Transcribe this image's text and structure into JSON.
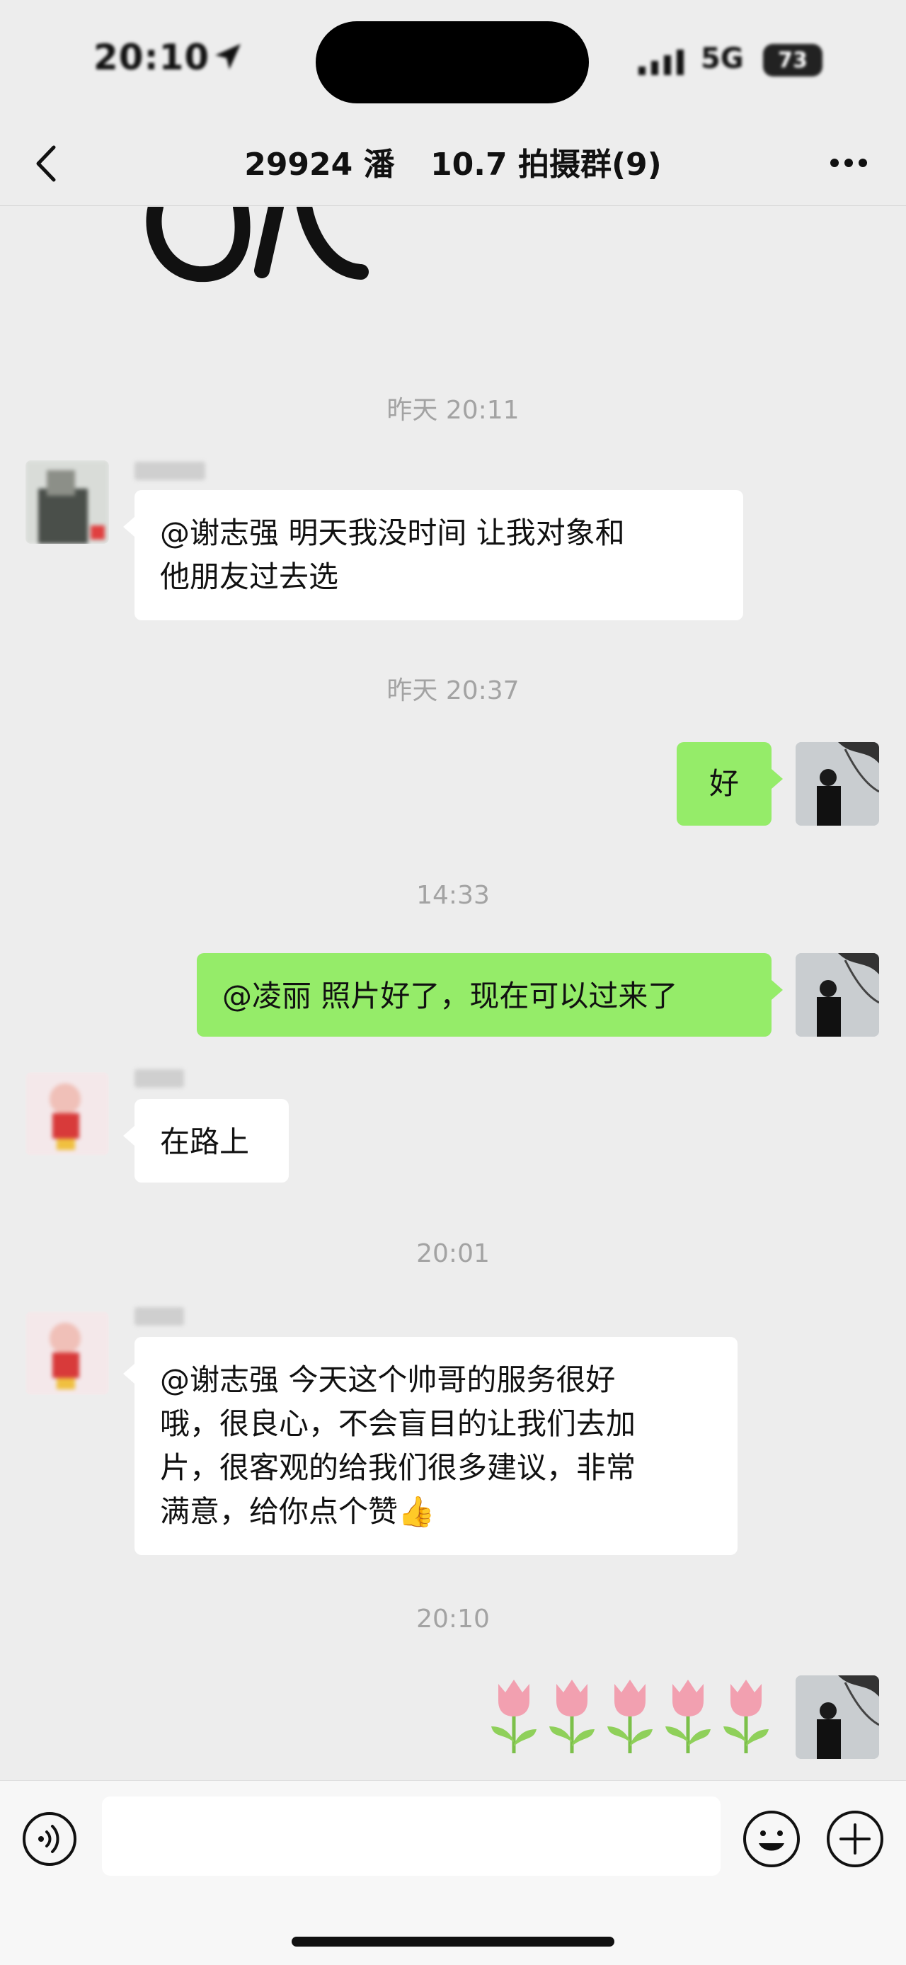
{
  "status_bar": {
    "time": "20:10",
    "network": "5G",
    "battery": "73"
  },
  "nav": {
    "title": "29924 潘     10.7 拍摄群(9)"
  },
  "messages": [
    {
      "timestamp": "昨天 20:11"
    },
    {
      "text": "@谢志强  明天我没时间  让我对象和\n他朋友过去选"
    },
    {
      "timestamp": "昨天 20:37"
    },
    {
      "text": "好"
    },
    {
      "timestamp": "14:33"
    },
    {
      "text": "@凌丽 照片好了，现在可以过来了"
    },
    {
      "text": "在路上"
    },
    {
      "timestamp": "20:01"
    },
    {
      "text": "@谢志强 今天这个帅哥的服务很好\n哦，很良心，不会盲目的让我们去加\n片，很客观的给我们很多建议，非常\n满意，给你点个赞👍"
    },
    {
      "timestamp": "20:10"
    },
    {
      "emoji": "🌷🌷🌷🌷🌷"
    }
  ],
  "input": {
    "placeholder": ""
  },
  "colors": {
    "background": "#ededed",
    "sent_bubble": "#95ec69",
    "received_bubble": "#ffffff"
  }
}
